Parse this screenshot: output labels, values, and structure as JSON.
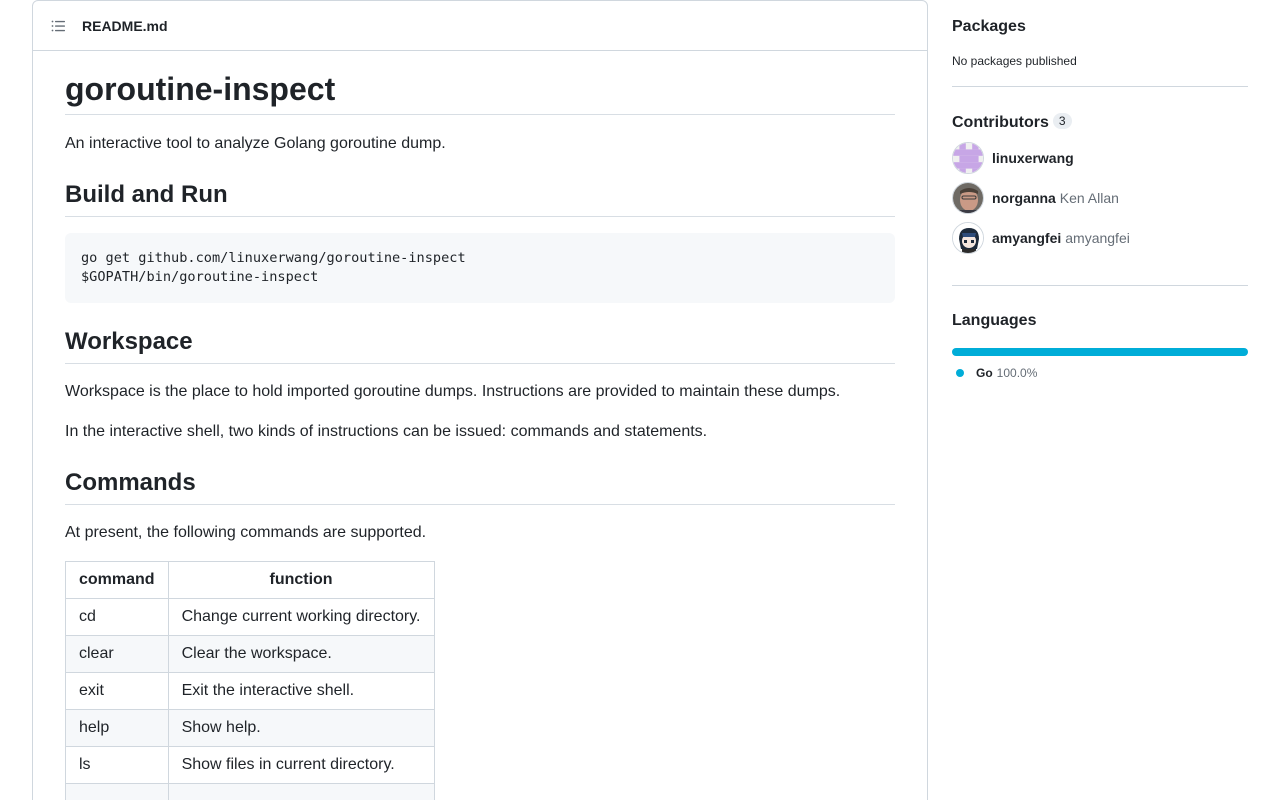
{
  "readme": {
    "filename": "README.md",
    "title": "goroutine-inspect",
    "intro": "An interactive tool to analyze Golang goroutine dump.",
    "build_heading": "Build and Run",
    "code_line1": "go get github.com/linuxerwang/goroutine-inspect",
    "code_line2": "$GOPATH/bin/goroutine-inspect",
    "workspace_heading": "Workspace",
    "workspace_p1": "Workspace is the place to hold imported goroutine dumps. Instructions are provided to maintain these dumps.",
    "workspace_p2": "In the interactive shell, two kinds of instructions can be issued: commands and statements.",
    "commands_heading": "Commands",
    "commands_intro": "At present, the following commands are supported.",
    "table": {
      "headers": [
        "command",
        "function"
      ],
      "rows": [
        {
          "command": "cd",
          "function": "Change current working directory."
        },
        {
          "command": "clear",
          "function": "Clear the workspace."
        },
        {
          "command": "exit",
          "function": "Exit the interactive shell."
        },
        {
          "command": "help",
          "function": "Show help."
        },
        {
          "command": "ls",
          "function": "Show files in current directory."
        }
      ]
    }
  },
  "sidebar": {
    "packages_heading": "Packages",
    "packages_text": "No packages published",
    "contributors_heading": "Contributors",
    "contributors_count": "3",
    "contributors": [
      {
        "login": "linuxerwang",
        "name": ""
      },
      {
        "login": "norganna",
        "name": "Ken Allan"
      },
      {
        "login": "amyangfei",
        "name": "amyangfei"
      }
    ],
    "languages_heading": "Languages",
    "languages": [
      {
        "name": "Go",
        "percent": "100.0%",
        "color": "#00ADD8"
      }
    ]
  },
  "icons": {
    "toc": "list-unordered-icon"
  },
  "colors": {
    "border": "#d0d7de",
    "code_bg": "#f6f8fa",
    "go": "#00ADD8",
    "text": "#1f2328",
    "muted": "#656d76"
  }
}
